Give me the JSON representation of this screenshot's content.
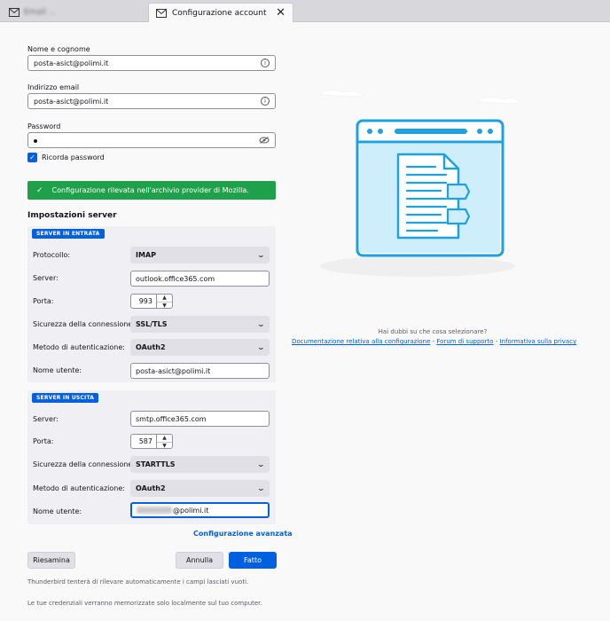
{
  "tabs": [
    {
      "label": "Email ...",
      "active": false
    },
    {
      "label": "Configurazione account",
      "active": true
    }
  ],
  "form": {
    "name_label": "Nome e cognome",
    "name_value": "posta-asict@polimi.it",
    "email_label": "Indirizzo email",
    "email_value": "posta-asict@polimi.it",
    "password_label": "Password",
    "remember_label": "Ricorda password",
    "remember_checked": true,
    "notice": "Configurazione rilevata nell'archivio provider di Mozilla."
  },
  "server_settings": {
    "title": "Impostazioni server",
    "incoming": {
      "badge": "SERVER IN ENTRATA",
      "protocol_label": "Protocollo:",
      "protocol_value": "IMAP",
      "server_label": "Server:",
      "server_value": "outlook.office365.com",
      "port_label": "Porta:",
      "port_value": "993",
      "security_label": "Sicurezza della connessione:",
      "security_value": "SSL/TLS",
      "auth_label": "Metodo di autenticazione:",
      "auth_value": "OAuth2",
      "user_label": "Nome utente:",
      "user_value": "posta-asict@polimi.it"
    },
    "outgoing": {
      "badge": "SERVER IN USCITA",
      "server_label": "Server:",
      "server_value": "smtp.office365.com",
      "port_label": "Porta:",
      "port_value": "587",
      "security_label": "Sicurezza della connessione:",
      "security_value": "STARTTLS",
      "auth_label": "Metodo di autenticazione:",
      "auth_value": "OAuth2",
      "user_label": "Nome utente:",
      "user_value_suffix": "@polimi.it"
    },
    "advanced_link": "Configurazione avanzata"
  },
  "buttons": {
    "retest": "Riesamina",
    "cancel": "Annulla",
    "done": "Fatto"
  },
  "notes": {
    "autodetect": "Thunderbird tenterà di rilevare automaticamente i campi lasciati vuoti.",
    "local": "Le tue credenziali verranno memorizzate solo localmente sul tuo computer."
  },
  "help": {
    "question": "Hai dubbi su che cosa selezionare?",
    "doc_link": "Documentazione relativa alla configurazione",
    "sep": " - ",
    "forum_link": "Forum di supporto",
    "privacy_link": "Informativa sulla privacy"
  },
  "colors": {
    "accent": "#0061e0",
    "success": "#1fa04a",
    "illustration": "#1da1e0"
  },
  "icons": {
    "tab_mail": "envelope-icon",
    "info": "info-icon",
    "eye": "eye-slash-icon",
    "check": "checkmark-icon",
    "chevron": "chevron-down-icon"
  }
}
